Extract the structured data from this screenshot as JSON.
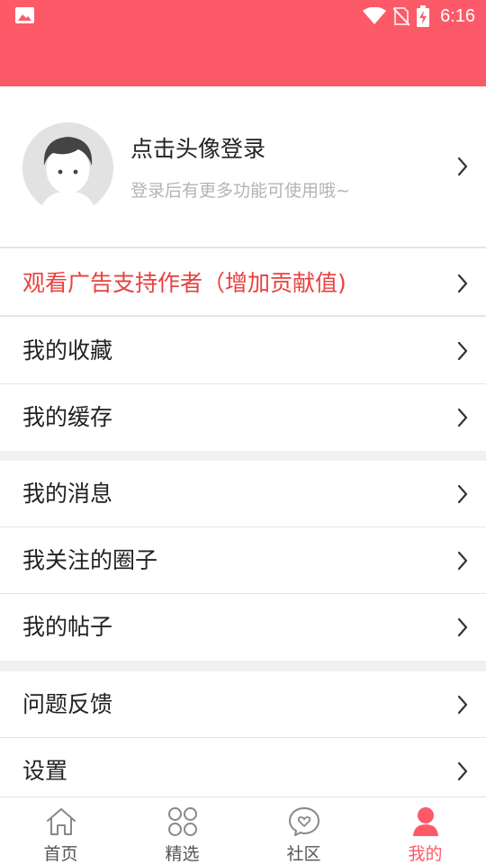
{
  "status_bar": {
    "time": "6:16"
  },
  "profile": {
    "title": "点击头像登录",
    "subtitle": "登录后有更多功能可使用哦~"
  },
  "menu": {
    "ad_support": "观看广告支持作者（增加贡献值)",
    "favorites": "我的收藏",
    "cache": "我的缓存",
    "messages": "我的消息",
    "followed_circles": "我关注的圈子",
    "posts": "我的帖子",
    "feedback": "问题反馈",
    "settings": "设置"
  },
  "tabbar": {
    "home": "首页",
    "featured": "精选",
    "community": "社区",
    "mine": "我的",
    "active": "mine"
  },
  "colors": {
    "brand": "#fc5a68",
    "ad_text": "#e8413f"
  }
}
